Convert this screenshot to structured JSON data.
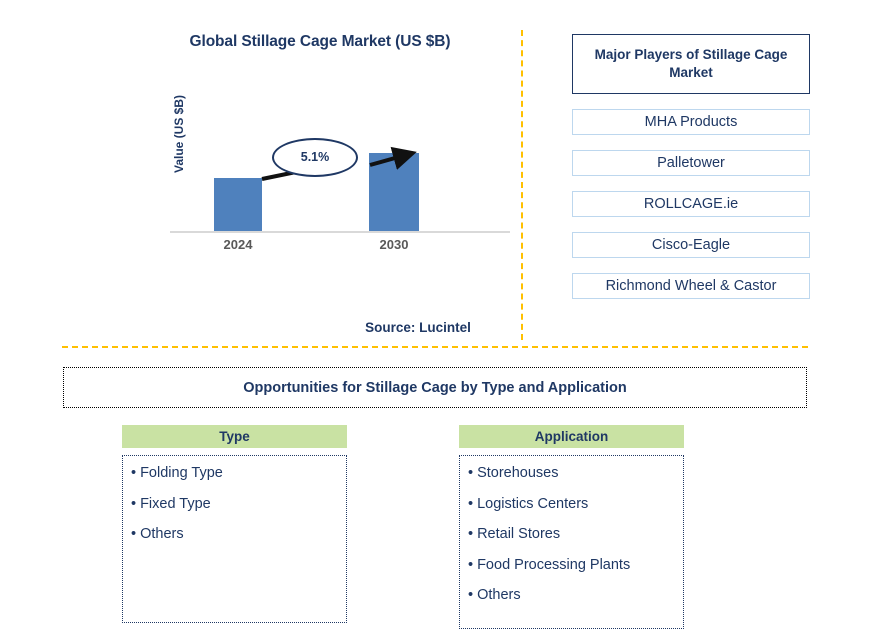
{
  "chart": {
    "title": "Global Stillage Cage Market (US $B)",
    "y_axis_label": "Value (US $B)",
    "cagr_label": "5.1%",
    "source": "Source: Lucintel"
  },
  "chart_data": {
    "type": "bar",
    "title": "Global Stillage Cage Market (US $B)",
    "categories": [
      "2024",
      "2030"
    ],
    "values": [
      1.0,
      1.35
    ],
    "xlabel": "",
    "ylabel": "Value (US $B)",
    "ylim": [
      0,
      1.6
    ],
    "grid": false,
    "legend": "none",
    "bar_color": "#4F81BD",
    "annotations": [
      {
        "text": "5.1%",
        "type": "cagr-callout",
        "between": [
          "2024",
          "2030"
        ]
      }
    ],
    "source": "Source: Lucintel"
  },
  "players": {
    "header": "Major Players of Stillage Cage Market",
    "items": [
      {
        "label": "MHA Products"
      },
      {
        "label": "Palletower"
      },
      {
        "label": "ROLLCAGE.ie"
      },
      {
        "label": "Cisco-Eagle"
      },
      {
        "label": "Richmond Wheel & Castor"
      }
    ]
  },
  "opportunities": {
    "banner": "Opportunities for Stillage Cage by Type and Application",
    "columns": [
      {
        "header": "Type",
        "items": [
          "Folding Type",
          "Fixed Type",
          "Others"
        ]
      },
      {
        "header": "Application",
        "items": [
          "Storehouses",
          "Logistics Centers",
          "Retail Stores",
          "Food Processing Plants",
          "Others"
        ]
      }
    ],
    "bullet": "•"
  },
  "colors": {
    "navy": "#1F3864",
    "bar_blue": "#4F81BD",
    "divider_gold": "#FFC000",
    "header_green": "#C9E2A3",
    "player_border": "#BDD7EE"
  }
}
